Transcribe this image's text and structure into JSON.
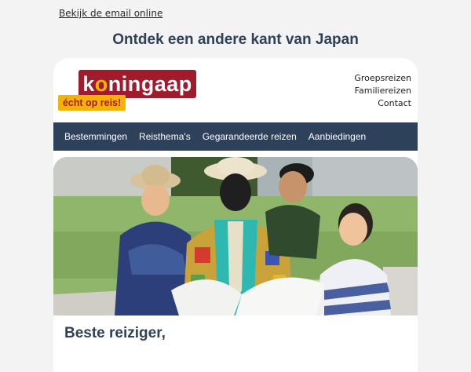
{
  "view_online": "Bekijk de email online",
  "headline": "Ontdek een andere kant van Japan",
  "logo": {
    "text": "koningaap",
    "tagline": "écht op reis!"
  },
  "top_links": [
    "Groepsreizen",
    "Familiereizen",
    "Contact"
  ],
  "nav": [
    "Bestemmingen",
    "Reisthema's",
    "Gegarandeerde reizen",
    "Aanbiedingen"
  ],
  "hero_image": "photo-travelers-with-statue",
  "greeting": "Beste reiziger,",
  "colors": {
    "headline": "#2f4157",
    "navbar": "#2e415a",
    "logo_red": "#a01c2c",
    "logo_yellow": "#f5b300",
    "background": "#f3f3f3"
  }
}
